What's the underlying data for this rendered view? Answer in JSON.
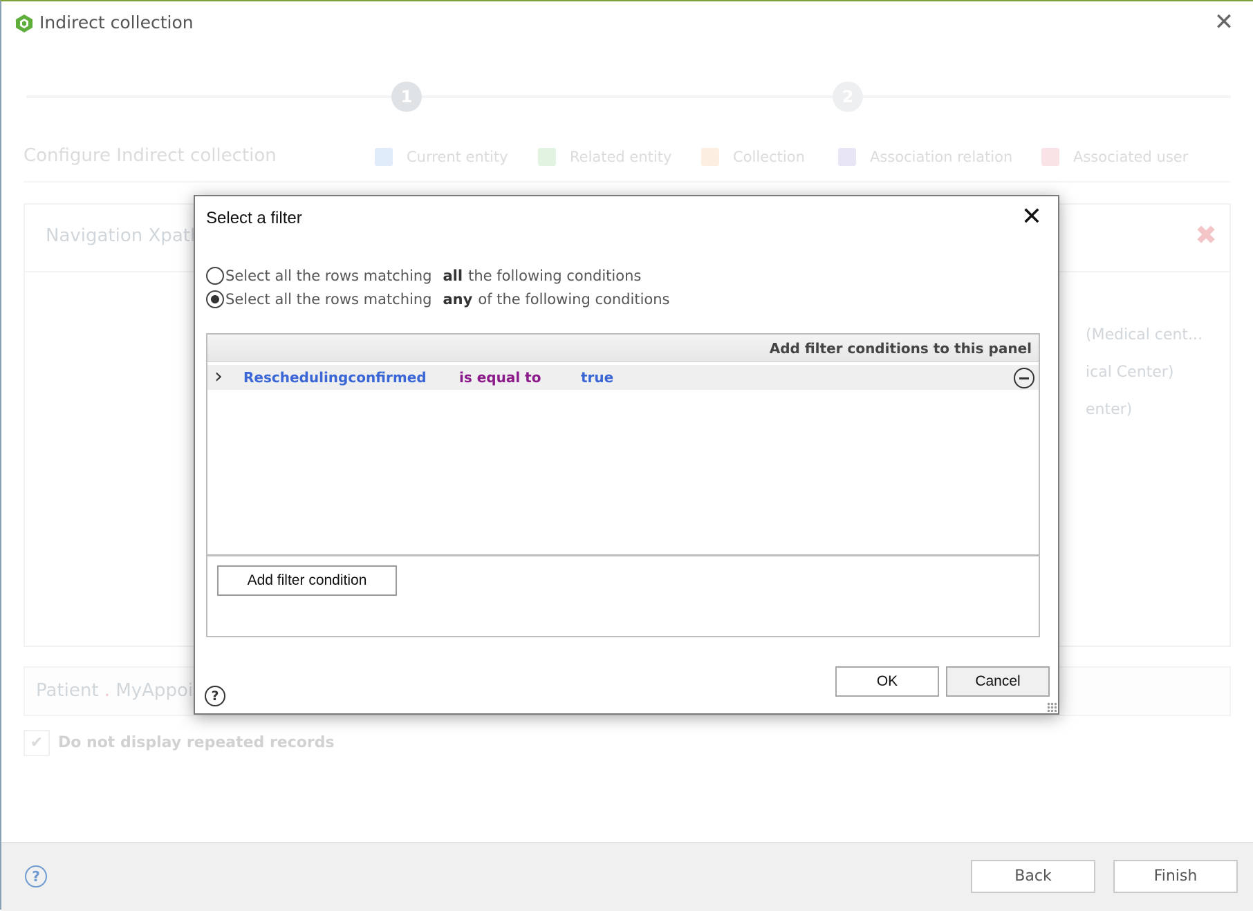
{
  "window": {
    "title": "Indirect collection",
    "close_glyph": "✕"
  },
  "wizard": {
    "steps": [
      "1",
      "2"
    ],
    "title": "Configure Indirect collection",
    "legend": [
      {
        "label": "Current entity",
        "color": "#9ec3f0"
      },
      {
        "label": "Related entity",
        "color": "#a6d9a0"
      },
      {
        "label": "Collection",
        "color": "#f7c99b"
      },
      {
        "label": "Association relation",
        "color": "#b6abe0"
      },
      {
        "label": "Associated user",
        "color": "#f0a6ad"
      }
    ],
    "xpath_label": "Navigation Xpath",
    "xpath_remove_glyph": "✖",
    "xpath_items": [
      "(Medical cent...",
      "ical Center)",
      "enter)"
    ],
    "path_parts": [
      "Patient",
      ".",
      "MyAppoint"
    ],
    "repeat_label": "Do not display repeated records",
    "repeat_check_glyph": "✔",
    "back_label": "Back",
    "finish_label": "Finish",
    "help_glyph": "?"
  },
  "dialog": {
    "title": "Select a filter",
    "close_glyph": "✕",
    "match_options": [
      {
        "prefix": "Select all the rows matching",
        "keyword": "all",
        "suffix": "the following conditions",
        "selected": false
      },
      {
        "prefix": "Select all the rows matching",
        "keyword": "any",
        "suffix": "of the following conditions",
        "selected": true
      }
    ],
    "panel_header": "Add filter conditions to this panel",
    "conditions": [
      {
        "expand_glyph": "›",
        "field": "Reschedulingconfirmed",
        "operator": "is equal to",
        "value": "true"
      }
    ],
    "add_condition_label": "Add filter condition",
    "ok_label": "OK",
    "cancel_label": "Cancel",
    "help_glyph": "?"
  }
}
